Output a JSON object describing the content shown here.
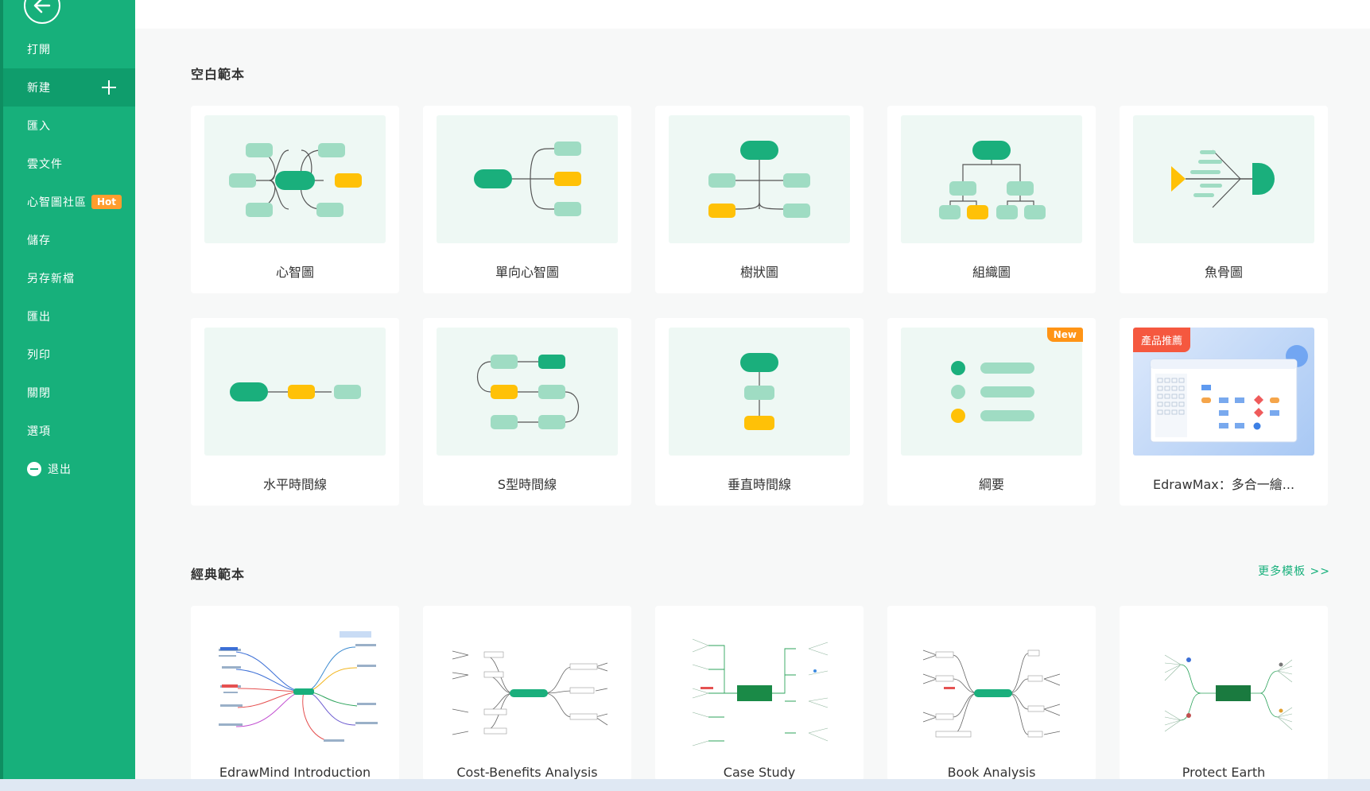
{
  "sidebar": {
    "items": [
      {
        "label": "打開"
      },
      {
        "label": "新建"
      },
      {
        "label": "匯入"
      },
      {
        "label": "雲文件"
      },
      {
        "label": "心智圖社區",
        "badge": "Hot"
      },
      {
        "label": "儲存"
      },
      {
        "label": "另存新檔"
      },
      {
        "label": "匯出"
      },
      {
        "label": "列印"
      },
      {
        "label": "關閉"
      },
      {
        "label": "選項"
      },
      {
        "label": "退出"
      }
    ]
  },
  "blank": {
    "title": "空白範本",
    "cards": [
      {
        "label": "心智圖"
      },
      {
        "label": "單向心智圖"
      },
      {
        "label": "樹狀圖"
      },
      {
        "label": "組織圖"
      },
      {
        "label": "魚骨圖"
      },
      {
        "label": "水平時間線"
      },
      {
        "label": "S型時間線"
      },
      {
        "label": "垂直時間線"
      },
      {
        "label": "綱要",
        "badge": "New"
      },
      {
        "label": "EdrawMax：多合一繪...",
        "badge": "產品推薦"
      }
    ]
  },
  "classic": {
    "title": "經典範本",
    "more": "更多模板 >>",
    "cards": [
      {
        "label": "EdrawMind Introduction"
      },
      {
        "label": "Cost-Benefits Analysis"
      },
      {
        "label": "Case Study"
      },
      {
        "label": "Book Analysis"
      },
      {
        "label": "Protect Earth"
      }
    ]
  },
  "colors": {
    "brand": "#17b07b",
    "node_green": "#1aaf7c",
    "node_light": "#9fdcc3",
    "node_yellow": "#ffc107"
  }
}
